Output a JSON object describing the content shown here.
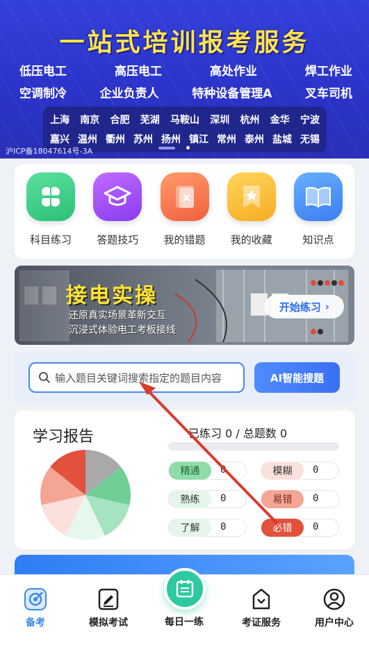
{
  "hero": {
    "title": "一站式培训报考服务",
    "services_row1": [
      "低压电工",
      "高压电工",
      "高处作业",
      "焊工作业"
    ],
    "services_row2": [
      "空调制冷",
      "企业负责人",
      "特种设备管理A",
      "叉车司机"
    ],
    "cities_row1": [
      "上海",
      "南京",
      "合肥",
      "芜湖",
      "马鞍山",
      "深圳",
      "杭州",
      "金华",
      "宁波"
    ],
    "cities_row2": [
      "嘉兴",
      "温州",
      "衢州",
      "苏州",
      "扬州",
      "镇江",
      "常州",
      "泰州",
      "盐城",
      "无锡"
    ],
    "icp": "沪ICP备18047614号-3A"
  },
  "menu": [
    {
      "label": "科目练习",
      "icon": "clover-icon"
    },
    {
      "label": "答题技巧",
      "icon": "graduation-cap-icon"
    },
    {
      "label": "我的错题",
      "icon": "error-book-icon"
    },
    {
      "label": "我的收藏",
      "icon": "star-bookmark-icon"
    },
    {
      "label": "知识点",
      "icon": "open-book-icon"
    }
  ],
  "practice_banner": {
    "title": "接电实操",
    "subtitle1": "还原真实场景革新交互",
    "subtitle2": "沉浸式体验电工考板接线",
    "button": "开始练习"
  },
  "search": {
    "placeholder": "输入题目关键词搜索指定的题目内容",
    "ai_button": "AI智能搜题"
  },
  "report": {
    "title": "学习报告",
    "practiced_label": "已练习",
    "practiced": "0",
    "total_label": "总题数",
    "total": "0",
    "separator": "/",
    "progress": 0,
    "stats": [
      {
        "label": "精通",
        "value": "0",
        "color": "#8fdcaa"
      },
      {
        "label": "模糊",
        "value": "0",
        "color": "#fbe1dc"
      },
      {
        "label": "熟练",
        "value": "0",
        "color": "#e4f6ea"
      },
      {
        "label": "易错",
        "value": "0",
        "color": "#f4a594"
      },
      {
        "label": "了解",
        "value": "0",
        "color": "#e4f6ea"
      },
      {
        "label": "必错",
        "value": "0",
        "color": "#e2513c"
      }
    ]
  },
  "nav": {
    "items": [
      {
        "label": "备考",
        "icon": "target-icon",
        "active": true
      },
      {
        "label": "模拟考试",
        "icon": "pen-paper-icon"
      },
      {
        "label": "每日一练",
        "icon": "calendar-list-icon"
      },
      {
        "label": "考证服务",
        "icon": "certificate-icon"
      },
      {
        "label": "用户中心",
        "icon": "user-icon"
      }
    ]
  },
  "colors": {
    "accent": "#3a6ff3",
    "hero_bg": "#2b33c8",
    "center_btn": "#2dc9a0",
    "arrow": "#d93a2e"
  }
}
